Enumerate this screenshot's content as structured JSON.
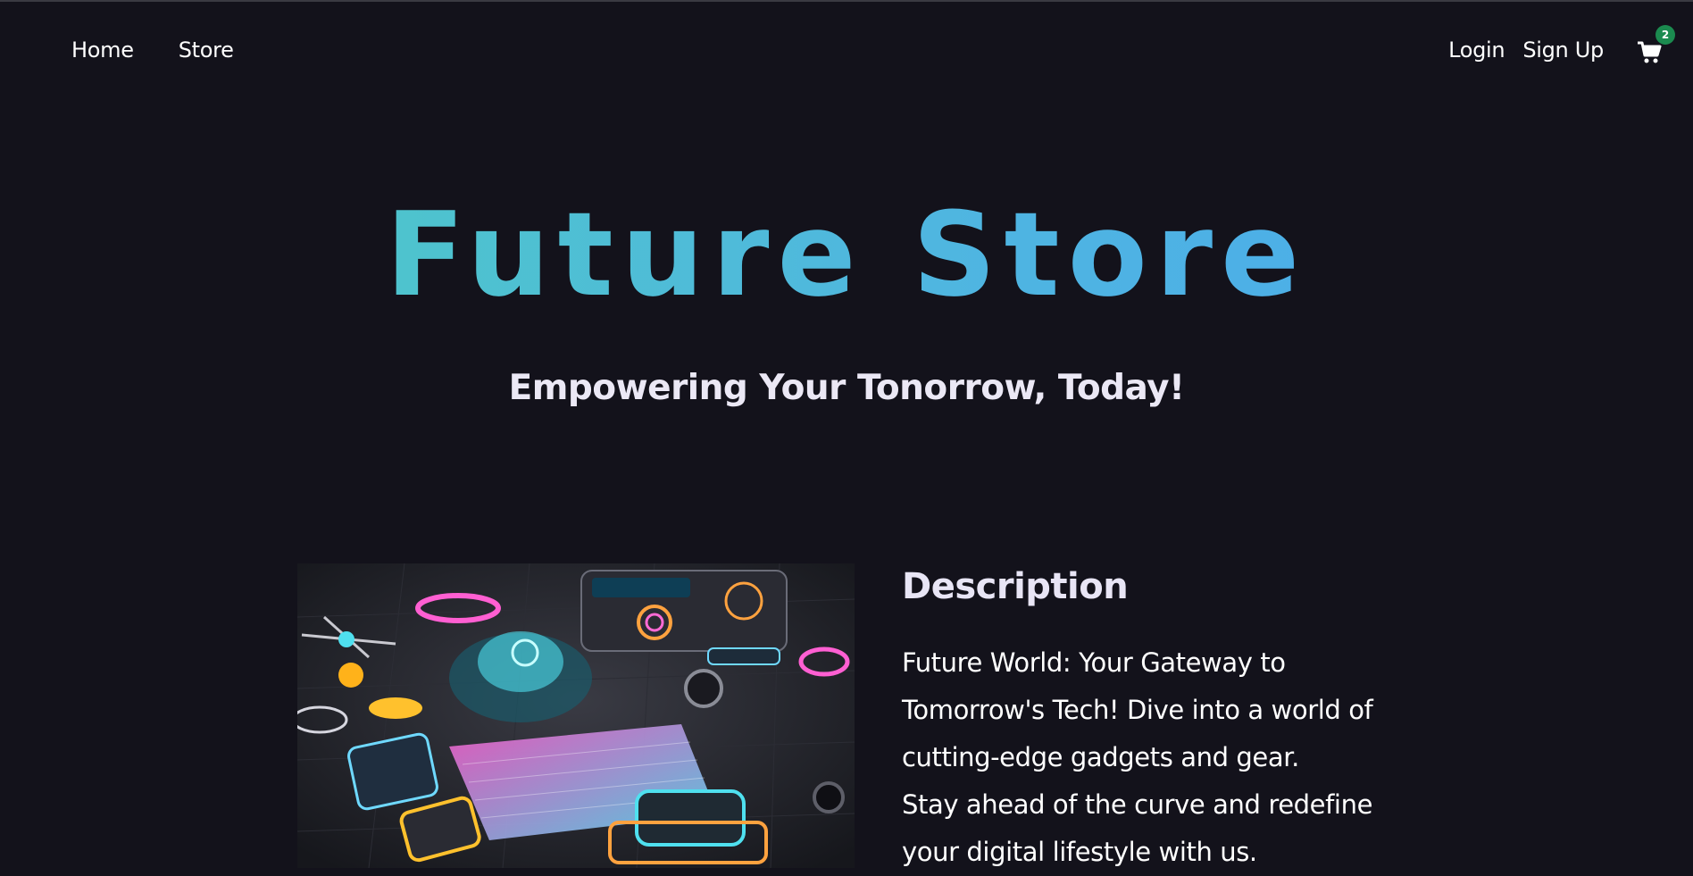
{
  "nav": {
    "left": [
      {
        "label": "Home"
      },
      {
        "label": "Store"
      }
    ],
    "login_label": "Login",
    "signup_label": "Sign Up",
    "cart": {
      "icon": "cart-icon",
      "count": "2"
    }
  },
  "hero": {
    "title": "Future Store",
    "subtitle": "Empowering Your Tonorrow, Today!"
  },
  "description": {
    "heading": "Description",
    "lines": [
      "Future World: Your Gateway to",
      "Tomorrow's Tech! Dive into a world of",
      "cutting-edge gadgets and gear.",
      "Stay ahead of the curve and redefine",
      "your digital lifestyle with us."
    ]
  },
  "colors": {
    "background": "#13121b",
    "title_gradient_start": "#4ecdc0",
    "title_gradient_end": "#4aa8ee",
    "badge": "#1b8a4f"
  }
}
